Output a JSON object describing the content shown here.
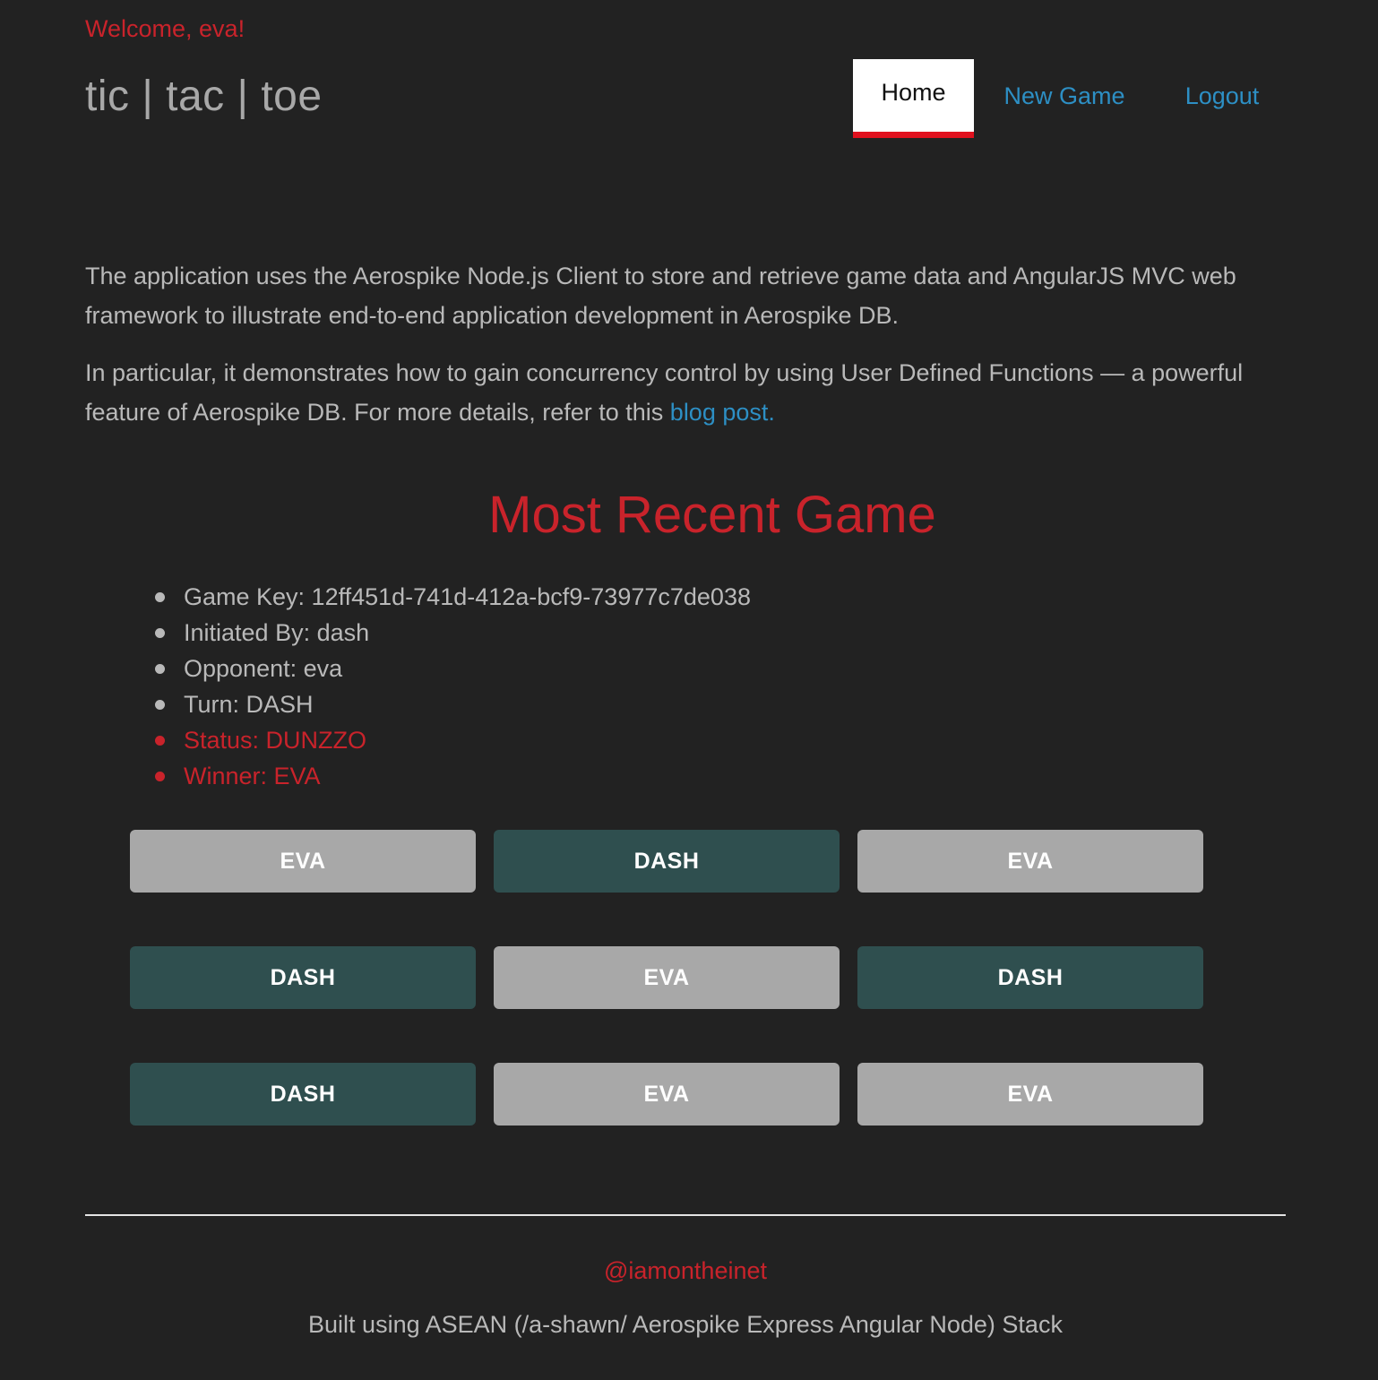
{
  "header": {
    "welcome": "Welcome, eva!",
    "brand": "tic | tac | toe",
    "nav": {
      "home": "Home",
      "new_game": "New Game",
      "logout": "Logout"
    }
  },
  "intro": {
    "p1": "The application uses the Aerospike Node.js Client to store and retrieve game data and AngularJS MVC web framework to illustrate end-to-end application development in Aerospike DB.",
    "p2_text": "In particular, it demonstrates how to gain concurrency control by using User Defined Functions — a powerful feature of Aerospike DB. For more details, refer to this ",
    "p2_link": "blog post."
  },
  "game": {
    "title": "Most Recent Game",
    "details": [
      "Game Key: 12ff451d-741d-412a-bcf9-73977c7de038",
      "Initiated By: dash",
      "Opponent: eva",
      "Turn: DASH",
      "Status: DUNZZO",
      "Winner: EVA"
    ],
    "board": [
      "EVA",
      "DASH",
      "EVA",
      "DASH",
      "EVA",
      "DASH",
      "DASH",
      "EVA",
      "EVA"
    ]
  },
  "footer": {
    "handle": "@iamontheinet",
    "built": "Built using ASEAN (/a-shawn/ Aerospike Express Angular Node) Stack"
  },
  "colors": {
    "background": "#222222",
    "accent_red": "#c9232b",
    "link_blue": "#2d8fc4",
    "eva_cell": "#a8a8a8",
    "dash_cell": "#2f4f4f"
  }
}
